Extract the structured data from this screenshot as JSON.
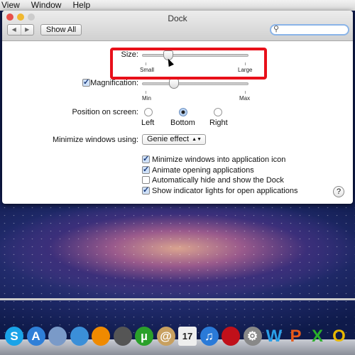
{
  "menubar": {
    "items": [
      "View",
      "Window",
      "Help"
    ]
  },
  "window": {
    "title": "Dock",
    "show_all": "Show All",
    "search_placeholder": "",
    "nav_back": "◀",
    "nav_forward": "▶"
  },
  "size": {
    "label": "Size:",
    "min_label": "Small",
    "max_label": "Large",
    "value_percent": 22
  },
  "magnification": {
    "label": "Magnification:",
    "checked": true,
    "min_label": "Min",
    "max_label": "Max",
    "value_percent": 28
  },
  "position": {
    "label": "Position on screen:",
    "options": [
      "Left",
      "Bottom",
      "Right"
    ],
    "selected": "Bottom"
  },
  "minimize": {
    "label": "Minimize windows using:",
    "value": "Genie effect",
    "arrow": "▲▼"
  },
  "checkboxes": [
    {
      "label": "Minimize windows into application icon",
      "checked": true
    },
    {
      "label": "Animate opening applications",
      "checked": true
    },
    {
      "label": "Automatically hide and show the Dock",
      "checked": false
    },
    {
      "label": "Show indicator lights for open applications",
      "checked": true
    }
  ],
  "help": "?",
  "highlight_color": "#e8101a",
  "dock": {
    "apps": [
      {
        "name": "skype-icon",
        "glyph": "S",
        "color": "#1aa3e8"
      },
      {
        "name": "app-store-icon",
        "glyph": "A",
        "color": "#2f7fd8"
      },
      {
        "name": "preview-icon",
        "glyph": "",
        "color": "#7a9ac8"
      },
      {
        "name": "safari-icon",
        "glyph": "",
        "color": "#3b8fd8"
      },
      {
        "name": "vlc-icon",
        "glyph": "",
        "color": "#f08a00"
      },
      {
        "name": "facetime-icon",
        "glyph": "",
        "color": "#555"
      },
      {
        "name": "utorrent-icon",
        "glyph": "µ",
        "color": "#2aa02a"
      },
      {
        "name": "address-book-icon",
        "glyph": "@",
        "color": "#c8a060"
      },
      {
        "name": "calendar-icon",
        "glyph": "17",
        "color": "#eee"
      },
      {
        "name": "itunes-icon",
        "glyph": "♫",
        "color": "#2a7ad8"
      },
      {
        "name": "photo-booth-icon",
        "glyph": "",
        "color": "#c0101a"
      },
      {
        "name": "system-preferences-icon",
        "glyph": "⚙",
        "color": "#888"
      },
      {
        "name": "word-icon",
        "glyph": "W",
        "color": "#2aa0e8"
      },
      {
        "name": "powerpoint-icon",
        "glyph": "P",
        "color": "#e85a1a"
      },
      {
        "name": "excel-icon",
        "glyph": "X",
        "color": "#2ab02a"
      },
      {
        "name": "outlook-icon",
        "glyph": "O",
        "color": "#e8b800"
      }
    ]
  }
}
